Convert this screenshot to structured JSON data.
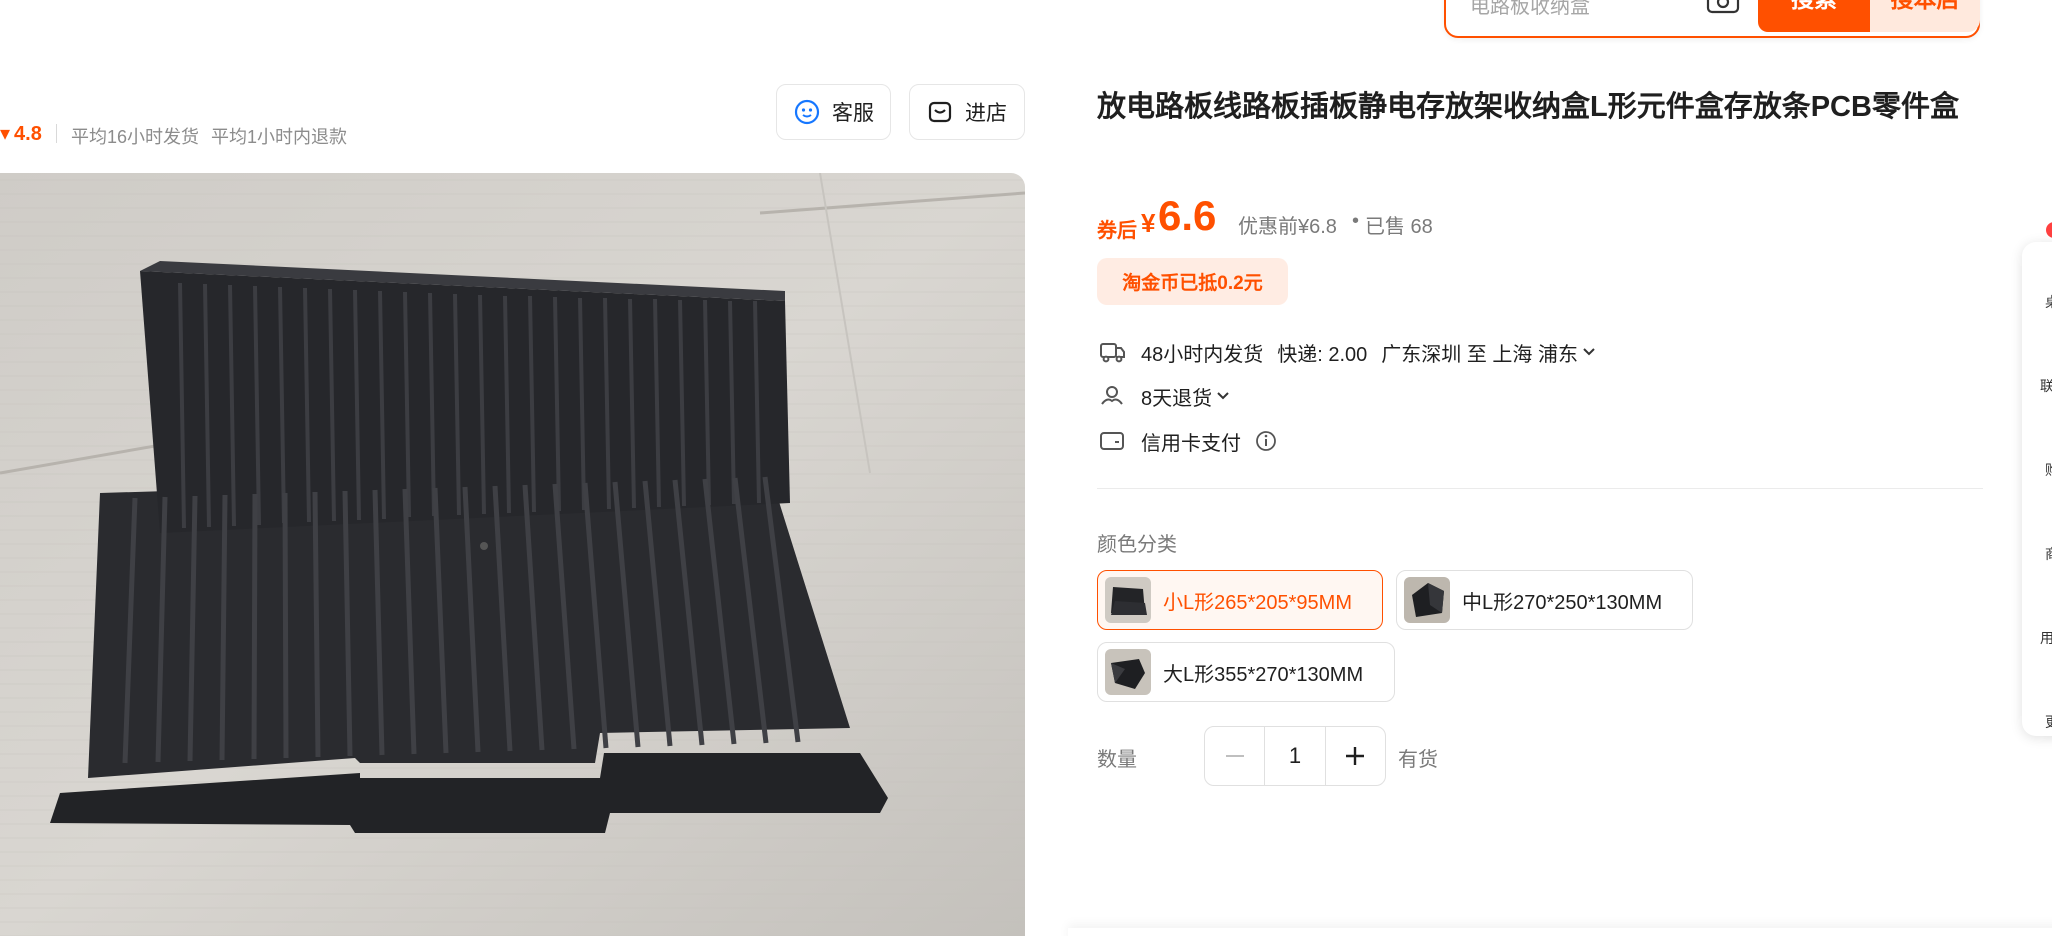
{
  "search": {
    "placeholder": "电路板收纳盒",
    "search_label": "搜索",
    "search_store_label": "搜本店"
  },
  "shop": {
    "rating": "4.8",
    "ship_stat": "平均16小时发货",
    "refund_stat": "平均1小时内退款",
    "service_label": "客服",
    "store_label": "进店"
  },
  "product": {
    "title": "放电路板线路板插板静电存放架收纳盒L形元件盒存放条PCB零件盒",
    "coupon_label": "券后",
    "currency": "¥",
    "price": "6.6",
    "original_price": "优惠前¥6.8",
    "dot": "•",
    "sold": "已售 68",
    "coin_badge": "淘金币已抵0.2元",
    "shipping_time": "48小时内发货",
    "express": "快递: 2.00",
    "route": "广东深圳 至 上海 浦东",
    "returns": "8天退货",
    "payment": "信用卡支付",
    "color_label": "颜色分类",
    "skus": [
      {
        "label": "小L形265*205*95MM",
        "selected": true
      },
      {
        "label": "中L形270*250*130MM",
        "selected": false
      },
      {
        "label": "大L形355*270*130MM",
        "selected": false
      }
    ],
    "quantity_label": "数量",
    "quantity": "1",
    "stock": "有货"
  },
  "sidebar": {
    "items": [
      "桌",
      "联系",
      "购",
      "商",
      "用户",
      "更"
    ]
  },
  "colors": {
    "accent": "#ff5000",
    "accent_light": "#ffece3",
    "text_muted": "#7a7a7a"
  }
}
